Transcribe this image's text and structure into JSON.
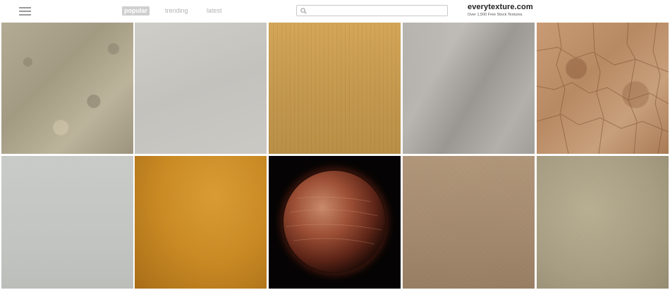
{
  "nav": {
    "tabs": [
      {
        "label": "popular",
        "active": true
      },
      {
        "label": "trending",
        "active": false
      },
      {
        "label": "latest",
        "active": false
      }
    ]
  },
  "search": {
    "value": "",
    "placeholder": ""
  },
  "brand": {
    "title": "everytexture.com",
    "subtitle": "Over 1,500 Free Stock Textures"
  },
  "colors": {
    "accent_tab_bg": "#cfcfcf",
    "muted_text": "#b3b3b3",
    "brand_text": "#222222"
  },
  "icons": {
    "menu": "hamburger-icon",
    "search": "search-icon"
  },
  "textures": [
    {
      "subject": "stone"
    },
    {
      "subject": "paper"
    },
    {
      "subject": "cardboard"
    },
    {
      "subject": "fabric"
    },
    {
      "subject": "cracked-dirt"
    },
    {
      "subject": "grey-paper"
    },
    {
      "subject": "gold"
    },
    {
      "subject": "planet"
    },
    {
      "subject": "canvas"
    },
    {
      "subject": "linen"
    }
  ]
}
